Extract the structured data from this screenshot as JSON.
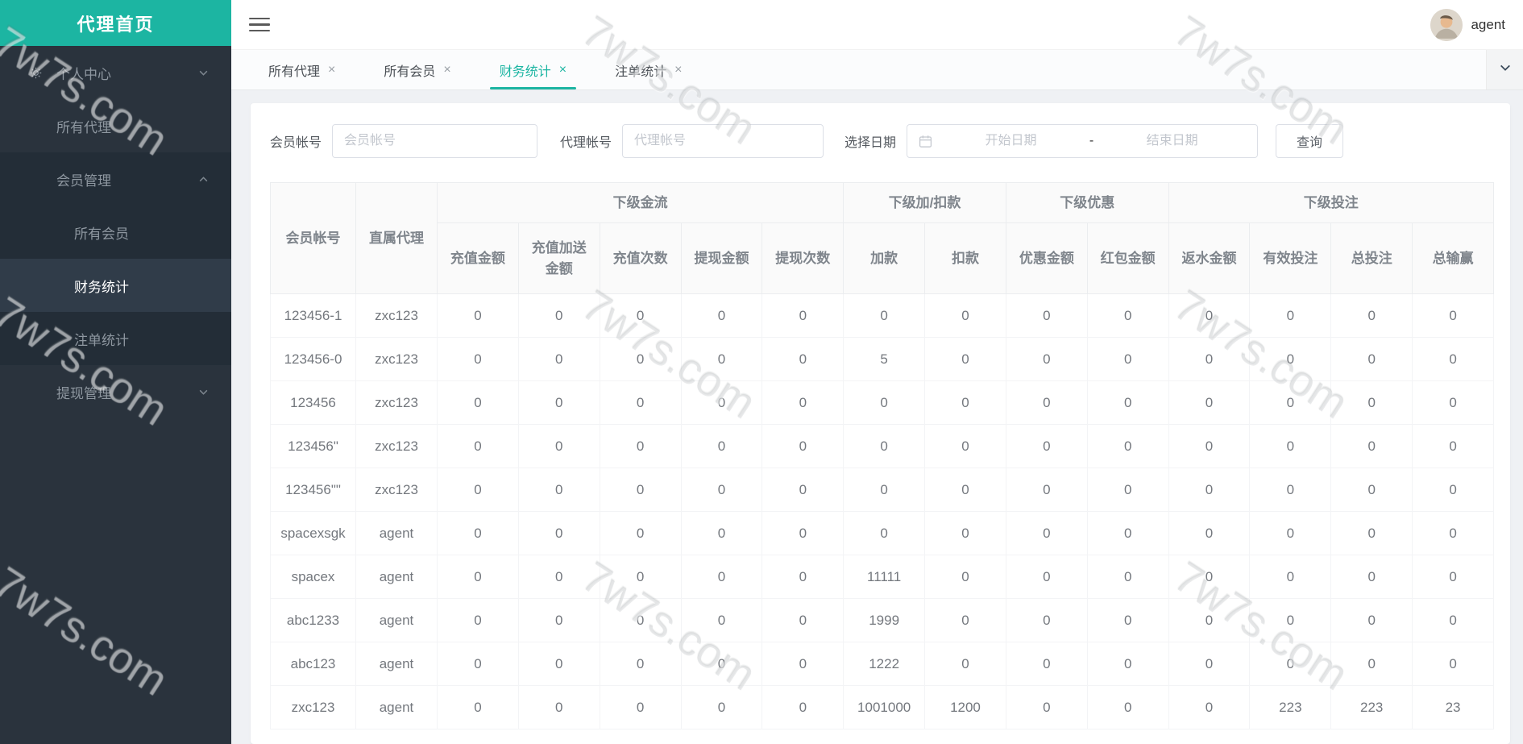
{
  "app": {
    "title": "代理首页",
    "watermark": "7w7s.com"
  },
  "topbar": {
    "username": "agent"
  },
  "sidebar": {
    "items": [
      {
        "label": "个人中心"
      },
      {
        "label": "所有代理"
      },
      {
        "label": "会员管理"
      },
      {
        "label": "所有会员"
      },
      {
        "label": "财务统计"
      },
      {
        "label": "注单统计"
      },
      {
        "label": "提现管理"
      }
    ]
  },
  "tabs": [
    {
      "label": "所有代理"
    },
    {
      "label": "所有会员"
    },
    {
      "label": "财务统计"
    },
    {
      "label": "注单统计"
    }
  ],
  "icons": {
    "close": "×"
  },
  "filters": {
    "member_label": "会员帐号",
    "member_placeholder": "会员帐号",
    "agent_label": "代理帐号",
    "agent_placeholder": "代理帐号",
    "date_label": "选择日期",
    "date_start_placeholder": "开始日期",
    "date_separator": "-",
    "date_end_placeholder": "结束日期",
    "search_button": "查询"
  },
  "table": {
    "corner_headers": [
      {
        "label": "会员帐号"
      },
      {
        "label": "直属代理"
      }
    ],
    "groups": [
      {
        "label": "下级金流",
        "colspan": 5
      },
      {
        "label": "下级加/扣款",
        "colspan": 2
      },
      {
        "label": "下级优惠",
        "colspan": 2
      },
      {
        "label": "下级投注",
        "colspan": 4
      }
    ],
    "columns": [
      "充值金额",
      "充值加送金额",
      "充值次数",
      "提现金额",
      "提现次数",
      "加款",
      "扣款",
      "优惠金额",
      "红包金额",
      "返水金额",
      "有效投注",
      "总投注",
      "总输赢"
    ],
    "rows": [
      [
        "123456-1",
        "zxc123",
        "0",
        "0",
        "0",
        "0",
        "0",
        "0",
        "0",
        "0",
        "0",
        "0",
        "0",
        "0",
        "0"
      ],
      [
        "123456-0",
        "zxc123",
        "0",
        "0",
        "0",
        "0",
        "0",
        "5",
        "0",
        "0",
        "0",
        "0",
        "0",
        "0",
        "0"
      ],
      [
        "123456",
        "zxc123",
        "0",
        "0",
        "0",
        "0",
        "0",
        "0",
        "0",
        "0",
        "0",
        "0",
        "0",
        "0",
        "0"
      ],
      [
        "123456\"",
        "zxc123",
        "0",
        "0",
        "0",
        "0",
        "0",
        "0",
        "0",
        "0",
        "0",
        "0",
        "0",
        "0",
        "0"
      ],
      [
        "123456\"\"",
        "zxc123",
        "0",
        "0",
        "0",
        "0",
        "0",
        "0",
        "0",
        "0",
        "0",
        "0",
        "0",
        "0",
        "0"
      ],
      [
        "spacexsgk",
        "agent",
        "0",
        "0",
        "0",
        "0",
        "0",
        "0",
        "0",
        "0",
        "0",
        "0",
        "0",
        "0",
        "0"
      ],
      [
        "spacex",
        "agent",
        "0",
        "0",
        "0",
        "0",
        "0",
        "11111",
        "0",
        "0",
        "0",
        "0",
        "0",
        "0",
        "0"
      ],
      [
        "abc1233",
        "agent",
        "0",
        "0",
        "0",
        "0",
        "0",
        "1999",
        "0",
        "0",
        "0",
        "0",
        "0",
        "0",
        "0"
      ],
      [
        "abc123",
        "agent",
        "0",
        "0",
        "0",
        "0",
        "0",
        "1222",
        "0",
        "0",
        "0",
        "0",
        "0",
        "0",
        "0"
      ],
      [
        "zxc123",
        "agent",
        "0",
        "0",
        "0",
        "0",
        "0",
        "1001000",
        "1200",
        "0",
        "0",
        "0",
        "223",
        "223",
        "23"
      ]
    ]
  }
}
